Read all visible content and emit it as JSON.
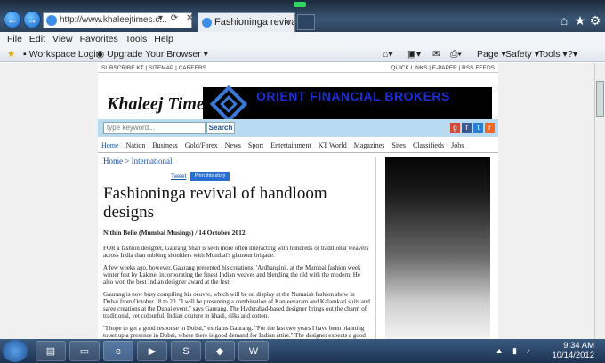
{
  "browser": {
    "address": "http://www.khaleejtimes.c...",
    "tab_title": "Fashioninga revival ...",
    "back": "←",
    "forward": "→",
    "addr_tools": "▾ ⟳ ✕"
  },
  "menu": [
    "File",
    "Edit",
    "View",
    "Favorites",
    "Tools",
    "Help"
  ],
  "favorites": {
    "workspace": "Workspace Login",
    "upgrade": "Upgrade Your Browser",
    "page": "Page",
    "safety": "Safety",
    "tools": "Tools"
  },
  "site": {
    "toplinks_left": "SUBSCRIBE KT | SITEMAP | CAREERS",
    "toplinks_right": "QUICK LINKS | E-PAPER | RSS FEEDS",
    "logo": "Khaleej Times",
    "banner": "ORIENT FINANCIAL BROKERS",
    "search_placeholder": "type keyword...",
    "search_button": "Search",
    "nav": [
      "Home",
      "Nation",
      "Business",
      "Gold/Forex",
      "News",
      "Sport",
      "Entertainment",
      "KT World",
      "Magazines",
      "Sites",
      "Classifieds",
      "Jobs"
    ],
    "breadcrumb": "Home > International",
    "tweet": "Tweet",
    "print": "Print this story"
  },
  "article": {
    "title": "Fashioninga revival of handloom designs",
    "byline": "Nithin Belle (Mumbai Musings) / 14 October 2012",
    "paragraphs": [
      "FOR a fashion designer, Gaurang Shah is seen more often interacting with hundreds of traditional weavers across India than rubbing shoulders with Mumbai's glamour brigade.",
      "A few weeks ago, however, Gaurang presented his creations, 'Ardhangini', at the Mumbai fashion week winter fest by Lakme, incorporating the finest Indian weaves and blending the old with the modern. He also won the best Indian designer award at the fest.",
      "Gaurang is now busy compiling his oeuvre, which will be on display at the Numaish fashion show in Dubai from October 18 to 20. \"I will be presenting a combination of Kanjeevaram and Kalamkari suits and saree creations at the Dubai event,\" says Gaurang. The Hyderabad-based designer brings out the charm of traditional, yet colourful, Indian couture in khadi, silks and cotton.",
      "\"I hope to get a good response in Dubai,\" explains Gaurang. \"For the last two years I have been planning to set up a presence in Dubai, where there is good demand for Indian attire.\" The designer expects a good response not just from Indian expatriates, but even other Asians, including Pakistanis"
    ]
  },
  "taskbar": {
    "time": "9:34 AM",
    "date": "10/14/2012"
  }
}
